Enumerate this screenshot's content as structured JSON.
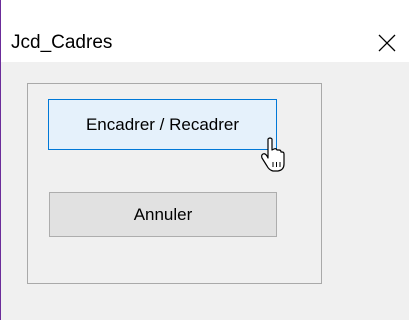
{
  "window": {
    "title": "Jcd_Cadres",
    "close_glyph": "✕"
  },
  "buttons": {
    "primary_label": "Encadrer / Recadrer",
    "secondary_label": "Annuler"
  },
  "colors": {
    "accent": "#0078d7",
    "button_hover_bg": "#e5f1fb",
    "button_bg": "#e1e1e1",
    "dialog_bg": "#f0f0f0"
  },
  "icons": {
    "close": "close-icon",
    "cursor": "mouse-pointer-icon"
  }
}
